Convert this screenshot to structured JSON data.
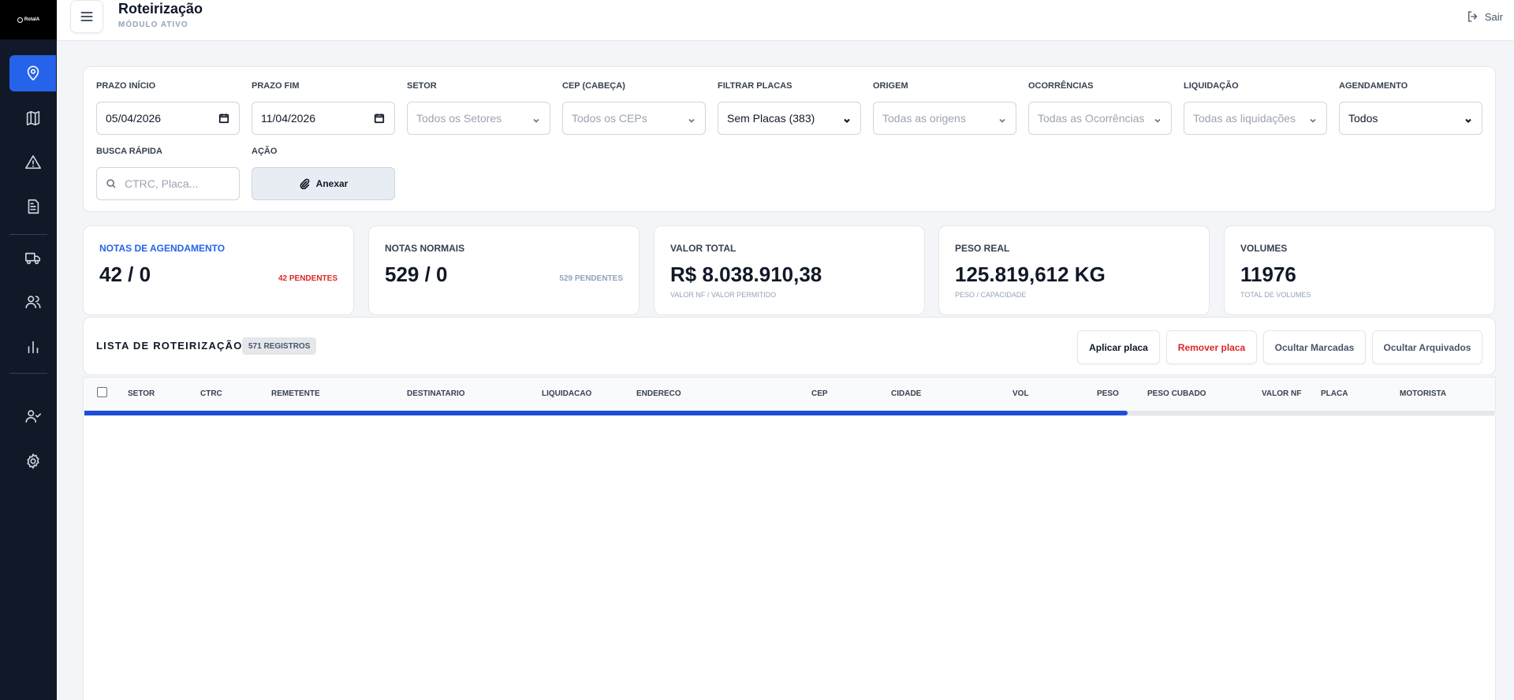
{
  "sidebar": {
    "logo_text": "RotaIA",
    "items": [
      {
        "name": "map-pin-icon",
        "active": true
      },
      {
        "name": "map-book-icon",
        "active": false
      },
      {
        "name": "alert-triangle-icon",
        "active": false
      },
      {
        "name": "document-icon",
        "active": false
      },
      {
        "name": "truck-icon",
        "active": false
      },
      {
        "name": "users-icon",
        "active": false
      },
      {
        "name": "bar-chart-icon",
        "active": false
      },
      {
        "name": "user-check-icon",
        "active": false
      },
      {
        "name": "settings-gear-icon",
        "active": false
      }
    ]
  },
  "header": {
    "title": "Roteirização",
    "subtitle": "MÓDULO ATIVO",
    "logout_label": "Sair"
  },
  "filters": {
    "prazo_inicio": {
      "label": "PRAZO INÍCIO",
      "value": "05/04/2026"
    },
    "prazo_fim": {
      "label": "PRAZO FIM",
      "value": "11/04/2026"
    },
    "setor": {
      "label": "SETOR",
      "placeholder": "Todos os Setores"
    },
    "cep": {
      "label": "CEP (CABEÇA)",
      "placeholder": "Todos os CEPs"
    },
    "placas": {
      "label": "FILTRAR PLACAS",
      "value": "Sem Placas (383)"
    },
    "origem": {
      "label": "ORIGEM",
      "placeholder": "Todas as origens"
    },
    "ocorrencias": {
      "label": "OCORRÊNCIAS",
      "placeholder": "Todas as Ocorrências"
    },
    "liquidacao": {
      "label": "LIQUIDAÇÃO",
      "placeholder": "Todas as liquidações"
    },
    "agendamento": {
      "label": "AGENDAMENTO",
      "value": "Todos"
    },
    "busca": {
      "label": "BUSCA RÁPIDA",
      "placeholder": "CTRC, Placa..."
    },
    "acao": {
      "label": "AÇÃO",
      "button": "Anexar"
    }
  },
  "cards": [
    {
      "label": "NOTAS DE AGENDAMENTO",
      "value": "42 / 0",
      "right": "42 PENDENTES"
    },
    {
      "label": "NOTAS NORMAIS",
      "value": "529 / 0",
      "right": "529 PENDENTES"
    },
    {
      "label": "VALOR TOTAL",
      "value": "R$ 8.038.910,38",
      "sub": "VALOR NF / VALOR PERMITIDO"
    },
    {
      "label": "PESO REAL",
      "value": "125.819,612 KG",
      "sub": "PESO / CAPACIDADE"
    },
    {
      "label": "VOLUMES",
      "value": "11976",
      "sub": "TOTAL DE VOLUMES"
    }
  ],
  "list": {
    "title": "LISTA DE ROTEIRIZAÇÃO",
    "count": "571 REGISTROS",
    "buttons": {
      "apply": "Aplicar placa",
      "remove": "Remover placa",
      "hide_marked": "Ocultar Marcadas",
      "hide_archived": "Ocultar Arquivados"
    },
    "columns": [
      "SETOR",
      "CTRC",
      "REMETENTE",
      "DESTINATARIO",
      "LIQUIDACAO",
      "ENDERECO",
      "CEP",
      "CIDADE",
      "VOL",
      "PESO",
      "PESO CUBADO",
      "VALOR NF",
      "PLACA",
      "MOTORISTA"
    ],
    "loading_progress": 0.74
  },
  "colors": {
    "sidebar": "#111827",
    "accent": "#2563eb",
    "danger": "#dc2626",
    "progress": "#1d4ed8"
  }
}
